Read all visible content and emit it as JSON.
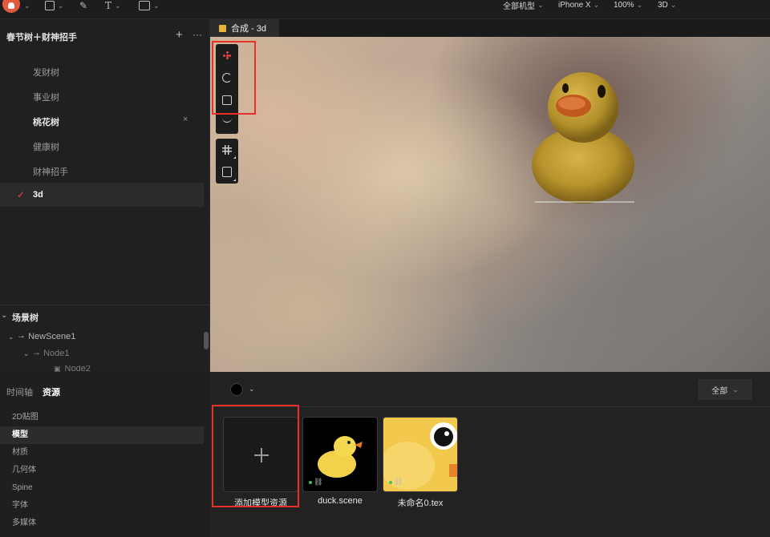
{
  "toolbar": {
    "icons": [
      "app-logo",
      "frame-icon",
      "pen-icon",
      "text-icon",
      "image-icon"
    ],
    "device_menu": "全部机型",
    "device": "iPhone X",
    "zoom": "100%",
    "mode": "3D"
  },
  "project": {
    "title": "春节树＋财神招手",
    "add_label": "+",
    "more_label": "···",
    "compositions": [
      {
        "label": "发财树"
      },
      {
        "label": "事业树"
      },
      {
        "label": "桃花树"
      },
      {
        "label": "健康树"
      },
      {
        "label": "财神招手"
      },
      {
        "label": "3d"
      }
    ],
    "active_index": 5,
    "check_mark": "✓",
    "close_mark": "×"
  },
  "scene": {
    "title": "场景树",
    "nodes": [
      "NewScene1",
      "Node1",
      "Node2"
    ]
  },
  "canvas": {
    "tab_label": "合成 - 3d",
    "tab_color": "#e8b43a",
    "tools": [
      "move-tool",
      "rotate-tool",
      "scale-tool",
      "arc-tool",
      "grid-tool",
      "cube-tool"
    ]
  },
  "bottom": {
    "tabs": [
      "时间轴",
      "资源"
    ],
    "active_tab": "资源",
    "categories": [
      "2D贴图",
      "模型",
      "材质",
      "几何体",
      "Spine",
      "字体",
      "多媒体"
    ],
    "active_category": "模型",
    "filter_label": "全部",
    "color_swatch": "#000000",
    "assets": [
      {
        "label": "添加模型资源",
        "type": "add"
      },
      {
        "label": "duck.scene",
        "type": "scene"
      },
      {
        "label": "未命名0.tex",
        "type": "texture"
      }
    ]
  },
  "colors": {
    "accent_red": "#e8302a",
    "check_red": "#e2463b",
    "status_green": "#35c759"
  }
}
